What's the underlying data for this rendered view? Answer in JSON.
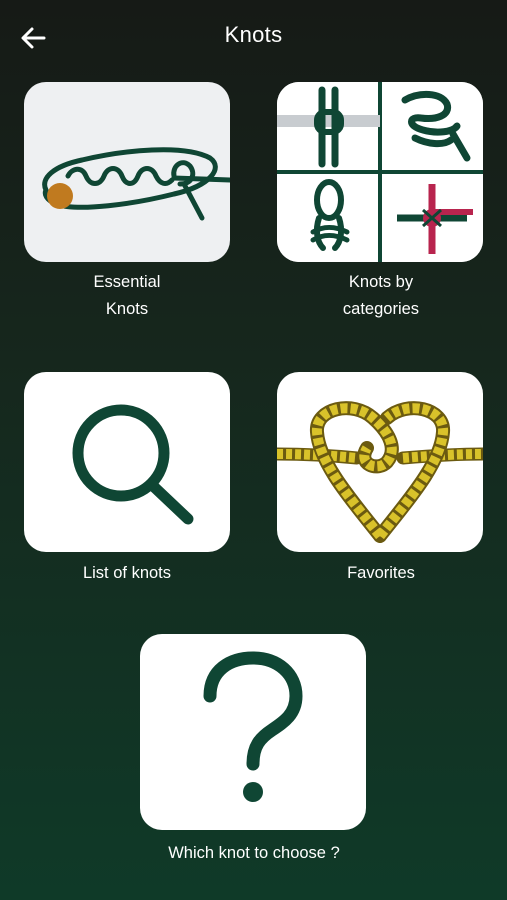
{
  "header": {
    "title": "Knots",
    "back_icon": "arrow-left-icon"
  },
  "menu": {
    "essential": {
      "line1": "Essential",
      "line2": "Knots",
      "icon": "knot-diagram-icon"
    },
    "categories": {
      "line1": "Knots by",
      "line2": "categories",
      "icon": "category-grid-icon"
    },
    "list": {
      "label": "List of knots",
      "icon": "search-icon"
    },
    "favorites": {
      "label": "Favorites",
      "icon": "rope-heart-icon"
    },
    "chooser": {
      "label": "Which knot to choose ?",
      "icon": "question-mark-icon"
    }
  },
  "colors": {
    "brand_green": "#0f4634",
    "rope_yellow": "#d9c22a",
    "accent_red": "#b8244e",
    "accent_orange": "#c07a1f",
    "tile_background": "#eef0f2"
  }
}
